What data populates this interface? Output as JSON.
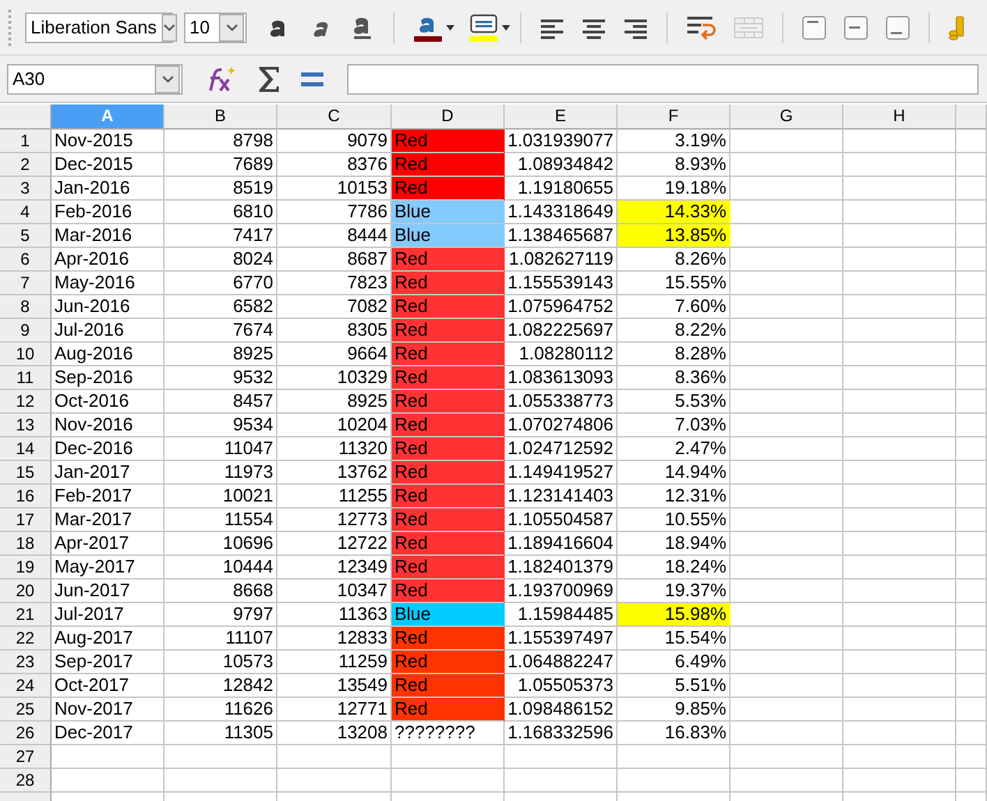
{
  "toolbar": {
    "font_name": "Liberation Sans",
    "font_size": "10"
  },
  "formula_bar": {
    "name_box": "A30"
  },
  "sheet": {
    "columns": [
      {
        "label": "A",
        "selected": true
      },
      {
        "label": "B",
        "selected": false
      },
      {
        "label": "C",
        "selected": false
      },
      {
        "label": "D",
        "selected": false
      },
      {
        "label": "E",
        "selected": false
      },
      {
        "label": "F",
        "selected": false
      },
      {
        "label": "G",
        "selected": false
      },
      {
        "label": "H",
        "selected": false
      }
    ],
    "rows": [
      {
        "header": "1",
        "cells": [
          {
            "text": "Nov-2015"
          },
          {
            "text": "8798"
          },
          {
            "text": "9079"
          },
          {
            "text": "Red",
            "color": "#ff0000"
          },
          {
            "text": "1.031939077"
          },
          {
            "text": "3.19%"
          }
        ]
      },
      {
        "header": "2",
        "cells": [
          {
            "text": "Dec-2015"
          },
          {
            "text": "7689"
          },
          {
            "text": "8376"
          },
          {
            "text": "Red",
            "color": "#ff0000"
          },
          {
            "text": "1.08934842"
          },
          {
            "text": "8.93%"
          }
        ]
      },
      {
        "header": "3",
        "cells": [
          {
            "text": "Jan-2016"
          },
          {
            "text": "8519"
          },
          {
            "text": "10153"
          },
          {
            "text": "Red",
            "color": "#ff0000"
          },
          {
            "text": "1.19180655"
          },
          {
            "text": "19.18%"
          }
        ]
      },
      {
        "header": "4",
        "cells": [
          {
            "text": "Feb-2016"
          },
          {
            "text": "6810"
          },
          {
            "text": "7786"
          },
          {
            "text": "Blue",
            "color": "#83caff"
          },
          {
            "text": "1.143318649"
          },
          {
            "text": "14.33%",
            "color": "#ffff00"
          }
        ]
      },
      {
        "header": "5",
        "cells": [
          {
            "text": "Mar-2016"
          },
          {
            "text": "7417"
          },
          {
            "text": "8444"
          },
          {
            "text": "Blue",
            "color": "#83caff"
          },
          {
            "text": "1.138465687"
          },
          {
            "text": "13.85%",
            "color": "#ffff00"
          }
        ]
      },
      {
        "header": "6",
        "cells": [
          {
            "text": "Apr-2016"
          },
          {
            "text": "8024"
          },
          {
            "text": "8687"
          },
          {
            "text": "Red",
            "color": "#ff3333"
          },
          {
            "text": "1.082627119"
          },
          {
            "text": "8.26%"
          }
        ]
      },
      {
        "header": "7",
        "cells": [
          {
            "text": "May-2016"
          },
          {
            "text": "6770"
          },
          {
            "text": "7823"
          },
          {
            "text": "Red",
            "color": "#ff3333"
          },
          {
            "text": "1.155539143"
          },
          {
            "text": "15.55%"
          }
        ]
      },
      {
        "header": "8",
        "cells": [
          {
            "text": "Jun-2016"
          },
          {
            "text": "6582"
          },
          {
            "text": "7082"
          },
          {
            "text": "Red",
            "color": "#ff3333"
          },
          {
            "text": "1.075964752"
          },
          {
            "text": "7.60%"
          }
        ]
      },
      {
        "header": "9",
        "cells": [
          {
            "text": "Jul-2016"
          },
          {
            "text": "7674"
          },
          {
            "text": "8305"
          },
          {
            "text": "Red",
            "color": "#ff3333"
          },
          {
            "text": "1.082225697"
          },
          {
            "text": "8.22%"
          }
        ]
      },
      {
        "header": "10",
        "cells": [
          {
            "text": "Aug-2016"
          },
          {
            "text": "8925"
          },
          {
            "text": "9664"
          },
          {
            "text": "Red",
            "color": "#ff3333"
          },
          {
            "text": "1.08280112"
          },
          {
            "text": "8.28%"
          }
        ]
      },
      {
        "header": "11",
        "cells": [
          {
            "text": "Sep-2016"
          },
          {
            "text": "9532"
          },
          {
            "text": "10329"
          },
          {
            "text": "Red",
            "color": "#ff3333"
          },
          {
            "text": "1.083613093"
          },
          {
            "text": "8.36%"
          }
        ]
      },
      {
        "header": "12",
        "cells": [
          {
            "text": "Oct-2016"
          },
          {
            "text": "8457"
          },
          {
            "text": "8925"
          },
          {
            "text": "Red",
            "color": "#ff3333"
          },
          {
            "text": "1.055338773"
          },
          {
            "text": "5.53%"
          }
        ]
      },
      {
        "header": "13",
        "cells": [
          {
            "text": "Nov-2016"
          },
          {
            "text": "9534"
          },
          {
            "text": "10204"
          },
          {
            "text": "Red",
            "color": "#ff3333"
          },
          {
            "text": "1.070274806"
          },
          {
            "text": "7.03%"
          }
        ]
      },
      {
        "header": "14",
        "cells": [
          {
            "text": "Dec-2016"
          },
          {
            "text": "11047"
          },
          {
            "text": "11320"
          },
          {
            "text": "Red",
            "color": "#ff3333"
          },
          {
            "text": "1.024712592"
          },
          {
            "text": "2.47%"
          }
        ]
      },
      {
        "header": "15",
        "cells": [
          {
            "text": "Jan-2017"
          },
          {
            "text": "11973"
          },
          {
            "text": "13762"
          },
          {
            "text": "Red",
            "color": "#ff3333"
          },
          {
            "text": "1.149419527"
          },
          {
            "text": "14.94%"
          }
        ]
      },
      {
        "header": "16",
        "cells": [
          {
            "text": "Feb-2017"
          },
          {
            "text": "10021"
          },
          {
            "text": "11255"
          },
          {
            "text": "Red",
            "color": "#ff3333"
          },
          {
            "text": "1.123141403"
          },
          {
            "text": "12.31%"
          }
        ]
      },
      {
        "header": "17",
        "cells": [
          {
            "text": "Mar-2017"
          },
          {
            "text": "11554"
          },
          {
            "text": "12773"
          },
          {
            "text": "Red",
            "color": "#ff3333"
          },
          {
            "text": "1.105504587"
          },
          {
            "text": "10.55%"
          }
        ]
      },
      {
        "header": "18",
        "cells": [
          {
            "text": "Apr-2017"
          },
          {
            "text": "10696"
          },
          {
            "text": "12722"
          },
          {
            "text": "Red",
            "color": "#ff3333"
          },
          {
            "text": "1.189416604"
          },
          {
            "text": "18.94%"
          }
        ]
      },
      {
        "header": "19",
        "cells": [
          {
            "text": "May-2017"
          },
          {
            "text": "10444"
          },
          {
            "text": "12349"
          },
          {
            "text": "Red",
            "color": "#ff3333"
          },
          {
            "text": "1.182401379"
          },
          {
            "text": "18.24%"
          }
        ]
      },
      {
        "header": "20",
        "cells": [
          {
            "text": "Jun-2017"
          },
          {
            "text": "8668"
          },
          {
            "text": "10347"
          },
          {
            "text": "Red",
            "color": "#ff3333"
          },
          {
            "text": "1.193700969"
          },
          {
            "text": "19.37%"
          }
        ]
      },
      {
        "header": "21",
        "cells": [
          {
            "text": "Jul-2017"
          },
          {
            "text": "9797"
          },
          {
            "text": "11363"
          },
          {
            "text": "Blue",
            "color": "#00ccff"
          },
          {
            "text": "1.15984485"
          },
          {
            "text": "15.98%",
            "color": "#ffff00"
          }
        ]
      },
      {
        "header": "22",
        "cells": [
          {
            "text": "Aug-2017"
          },
          {
            "text": "11107"
          },
          {
            "text": "12833"
          },
          {
            "text": "Red",
            "color": "#ff3300"
          },
          {
            "text": "1.155397497"
          },
          {
            "text": "15.54%"
          }
        ]
      },
      {
        "header": "23",
        "cells": [
          {
            "text": "Sep-2017"
          },
          {
            "text": "10573"
          },
          {
            "text": "11259"
          },
          {
            "text": "Red",
            "color": "#ff3300"
          },
          {
            "text": "1.064882247"
          },
          {
            "text": "6.49%"
          }
        ]
      },
      {
        "header": "24",
        "cells": [
          {
            "text": "Oct-2017"
          },
          {
            "text": "12842"
          },
          {
            "text": "13549"
          },
          {
            "text": "Red",
            "color": "#ff3300"
          },
          {
            "text": "1.05505373"
          },
          {
            "text": "5.51%"
          }
        ]
      },
      {
        "header": "25",
        "cells": [
          {
            "text": "Nov-2017"
          },
          {
            "text": "11626"
          },
          {
            "text": "12771"
          },
          {
            "text": "Red",
            "color": "#ff3300"
          },
          {
            "text": "1.098486152"
          },
          {
            "text": "9.85%"
          }
        ]
      },
      {
        "header": "26",
        "cells": [
          {
            "text": "Dec-2017"
          },
          {
            "text": "11305"
          },
          {
            "text": "13208"
          },
          {
            "text": "????????"
          },
          {
            "text": "1.168332596"
          },
          {
            "text": "16.83%"
          }
        ]
      },
      {
        "header": "27",
        "cells": []
      },
      {
        "header": "28",
        "cells": []
      }
    ]
  }
}
